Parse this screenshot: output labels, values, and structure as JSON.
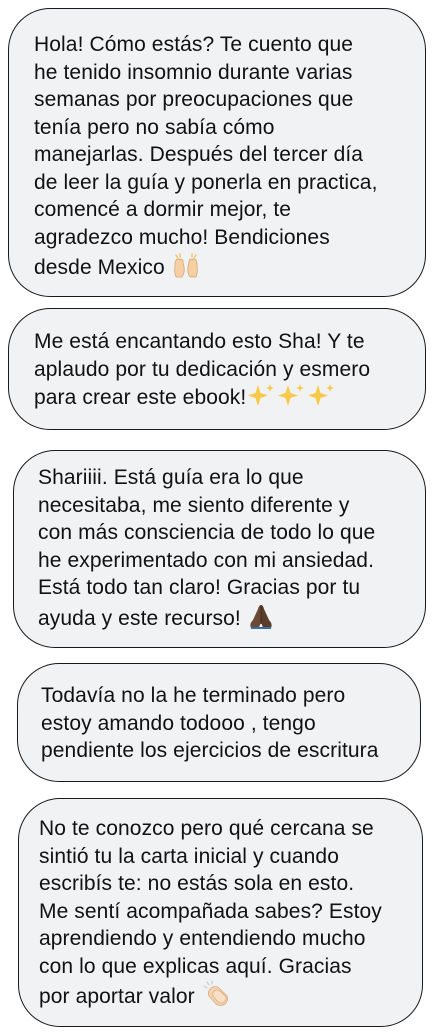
{
  "messages": [
    {
      "text": "Hola! Cómo estás? Te cuento que\nhe tenido insomnio durante varias\nsemanas por preocupaciones que\ntenía pero no sabía cómo\nmanejarlas. Después del tercer día\nde leer la guía y ponerla en practica,\ncomencé a dormir mejor, te\nagradezco mucho! Bendiciones\ndesde Mexico",
      "emoji": "raising-hands"
    },
    {
      "text": "Me está encantando esto Sha! Y te\naplaudo por tu dedicación y esmero\npara crear este ebook!",
      "emoji": "sparkles"
    },
    {
      "text": "Shariiii. Está guía era lo que\nnecesitaba, me siento diferente y\ncon más consciencia de todo lo que\nhe experimentado con mi ansiedad.\nEstá todo tan claro! Gracias por tu\nayuda y este recurso!",
      "emoji": "folded-hands"
    },
    {
      "text": "Todavía no la he terminado pero\nestoy amando todooo , tengo\npendiente los ejercicios de escritura",
      "emoji": ""
    },
    {
      "text": "No te conozco pero qué cercana se\nsintió tu la carta inicial y cuando\nescribís te: no estás sola en esto.\nMe sentí acompañada sabes? Estoy\naprendiendo y entendiendo mucho\ncon lo que explicas aquí. Gracias\npor aportar valor",
      "emoji": "clapping-hands"
    }
  ],
  "colors": {
    "bubble_background": "#f1f2f4",
    "bubble_border": "#1a1a1a",
    "text": "#111111",
    "sparkle": "#f7c948",
    "hands_light": "#f6cfa3",
    "hands_dark": "#6b4a36"
  }
}
